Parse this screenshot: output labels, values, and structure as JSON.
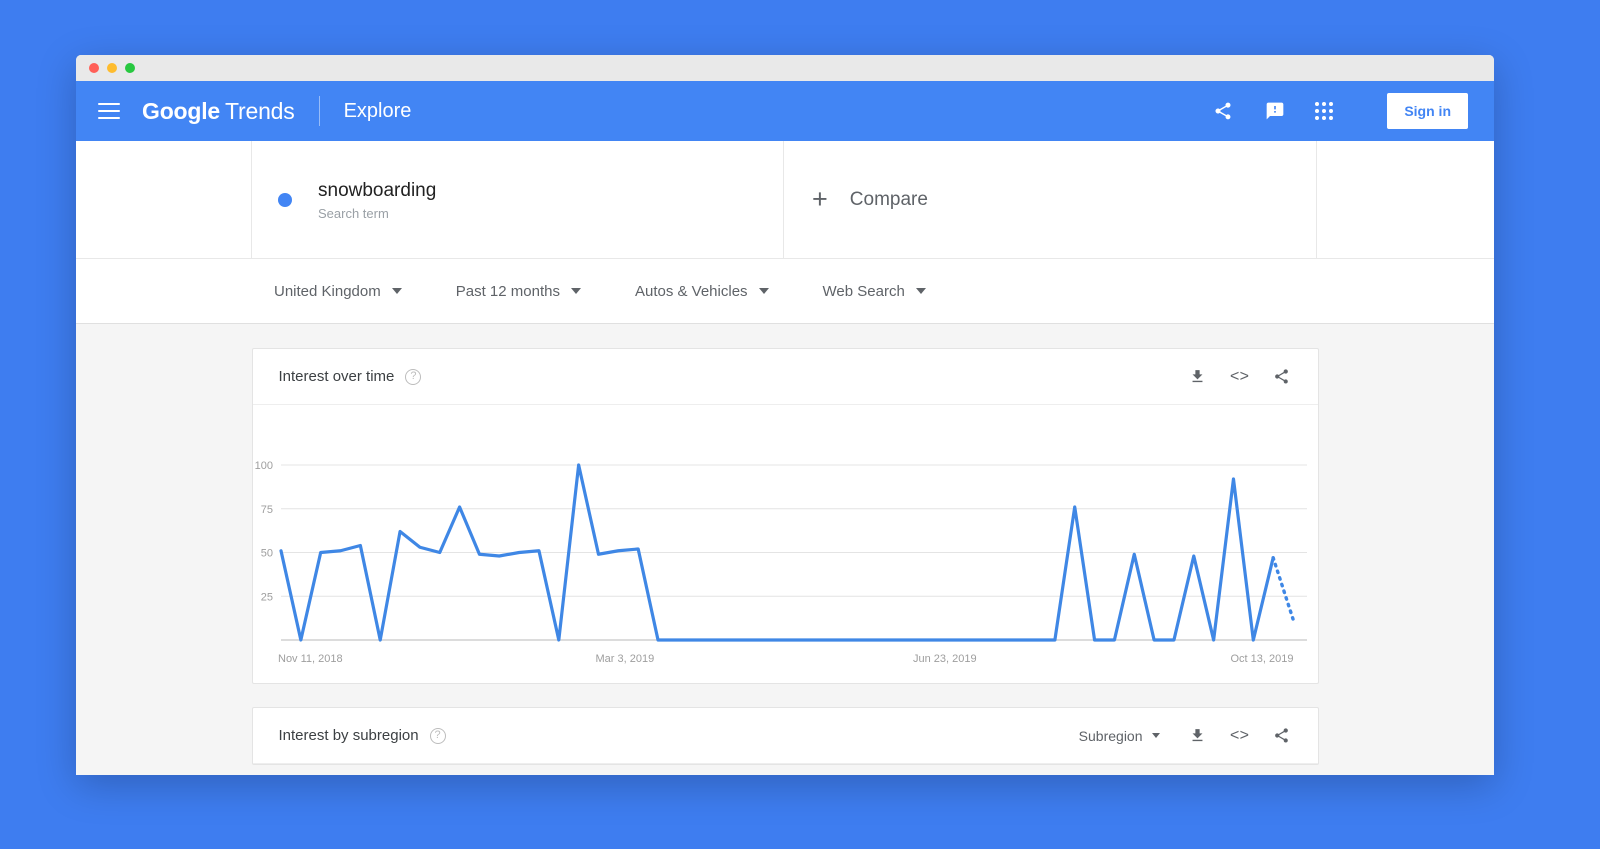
{
  "appbar": {
    "brand_google": "Google",
    "brand_trends": "Trends",
    "explore": "Explore",
    "signin": "Sign in",
    "icons": {
      "menu": "hamburger-menu-icon",
      "share": "share-icon",
      "feedback": "feedback-icon",
      "apps": "apps-grid-icon"
    }
  },
  "term": {
    "name": "snowboarding",
    "type": "Search term",
    "compare": "Compare",
    "plus": "+"
  },
  "filters": [
    {
      "label": "United Kingdom"
    },
    {
      "label": "Past 12 months"
    },
    {
      "label": "Autos & Vehicles"
    },
    {
      "label": "Web Search"
    }
  ],
  "cards": {
    "interest_over_time": {
      "title": "Interest over time",
      "help": "?"
    },
    "interest_by_subregion": {
      "title": "Interest by subregion",
      "help": "?",
      "selector": "Subregion"
    }
  },
  "colors": {
    "brand_blue": "#4285F4",
    "series_blue": "#3F87E5",
    "backdrop": "#3E7DF0",
    "grid": "#e4e4e4"
  },
  "chart_data": {
    "type": "line",
    "title": "Interest over time",
    "xlabel": "",
    "ylabel": "",
    "ylim": [
      0,
      100
    ],
    "yticks": [
      0,
      25,
      50,
      75,
      100
    ],
    "ytick_labels": [
      "",
      "25",
      "50",
      "75",
      "100"
    ],
    "grid": true,
    "legend": "none",
    "xtick_labels": [
      "Nov 11, 2018",
      "Mar 3, 2019",
      "Jun 23, 2019",
      "Oct 13, 2019"
    ],
    "xtick_indices": [
      0,
      16,
      32,
      48
    ],
    "series": [
      {
        "name": "snowboarding",
        "color": "#3F87E5",
        "values": [
          51,
          0,
          50,
          51,
          54,
          0,
          62,
          53,
          50,
          76,
          49,
          48,
          50,
          51,
          0,
          100,
          49,
          51,
          52,
          0,
          0,
          0,
          0,
          0,
          0,
          0,
          0,
          0,
          0,
          0,
          0,
          0,
          0,
          0,
          0,
          0,
          0,
          0,
          0,
          0,
          76,
          0,
          0,
          49,
          0,
          0,
          48,
          0,
          92,
          0,
          47
        ],
        "partial_from_index": 50,
        "partial_values": [
          47,
          12
        ]
      }
    ]
  }
}
